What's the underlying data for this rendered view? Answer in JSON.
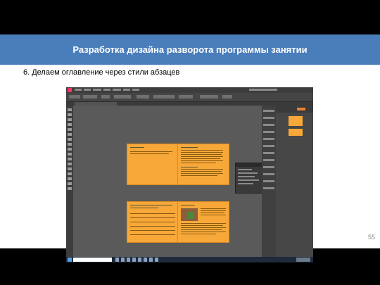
{
  "header": {
    "title": "Разработка дизайна разворота программы занятии"
  },
  "content": {
    "subtitle": "6. Делаем оглавление через стили абзацев"
  },
  "footer": {
    "page_number": "55"
  },
  "colors": {
    "header_bg": "#4a7ebb",
    "page_orange": "#f7a839",
    "app_dark": "#535353"
  }
}
